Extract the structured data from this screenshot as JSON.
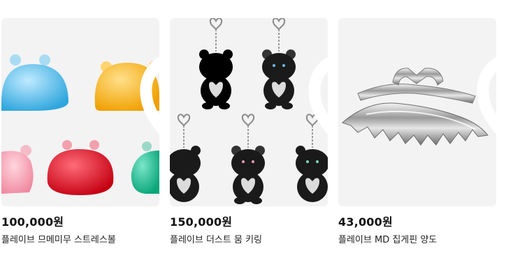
{
  "products": [
    {
      "price": "100,000원",
      "name": "플레이브 므메미무 스트레스볼"
    },
    {
      "price": "150,000원",
      "name": "플레이브 더스트 뭄 키링"
    },
    {
      "price": "43,000원",
      "name": "플레이브 MD 집게핀 양도"
    }
  ],
  "colors": {
    "thumb_bg": "#f3f3f3",
    "heart_outline": "#ffffff",
    "price_text": "#111111",
    "name_text": "#222222"
  },
  "icons": [
    "heart-outline-icon"
  ]
}
